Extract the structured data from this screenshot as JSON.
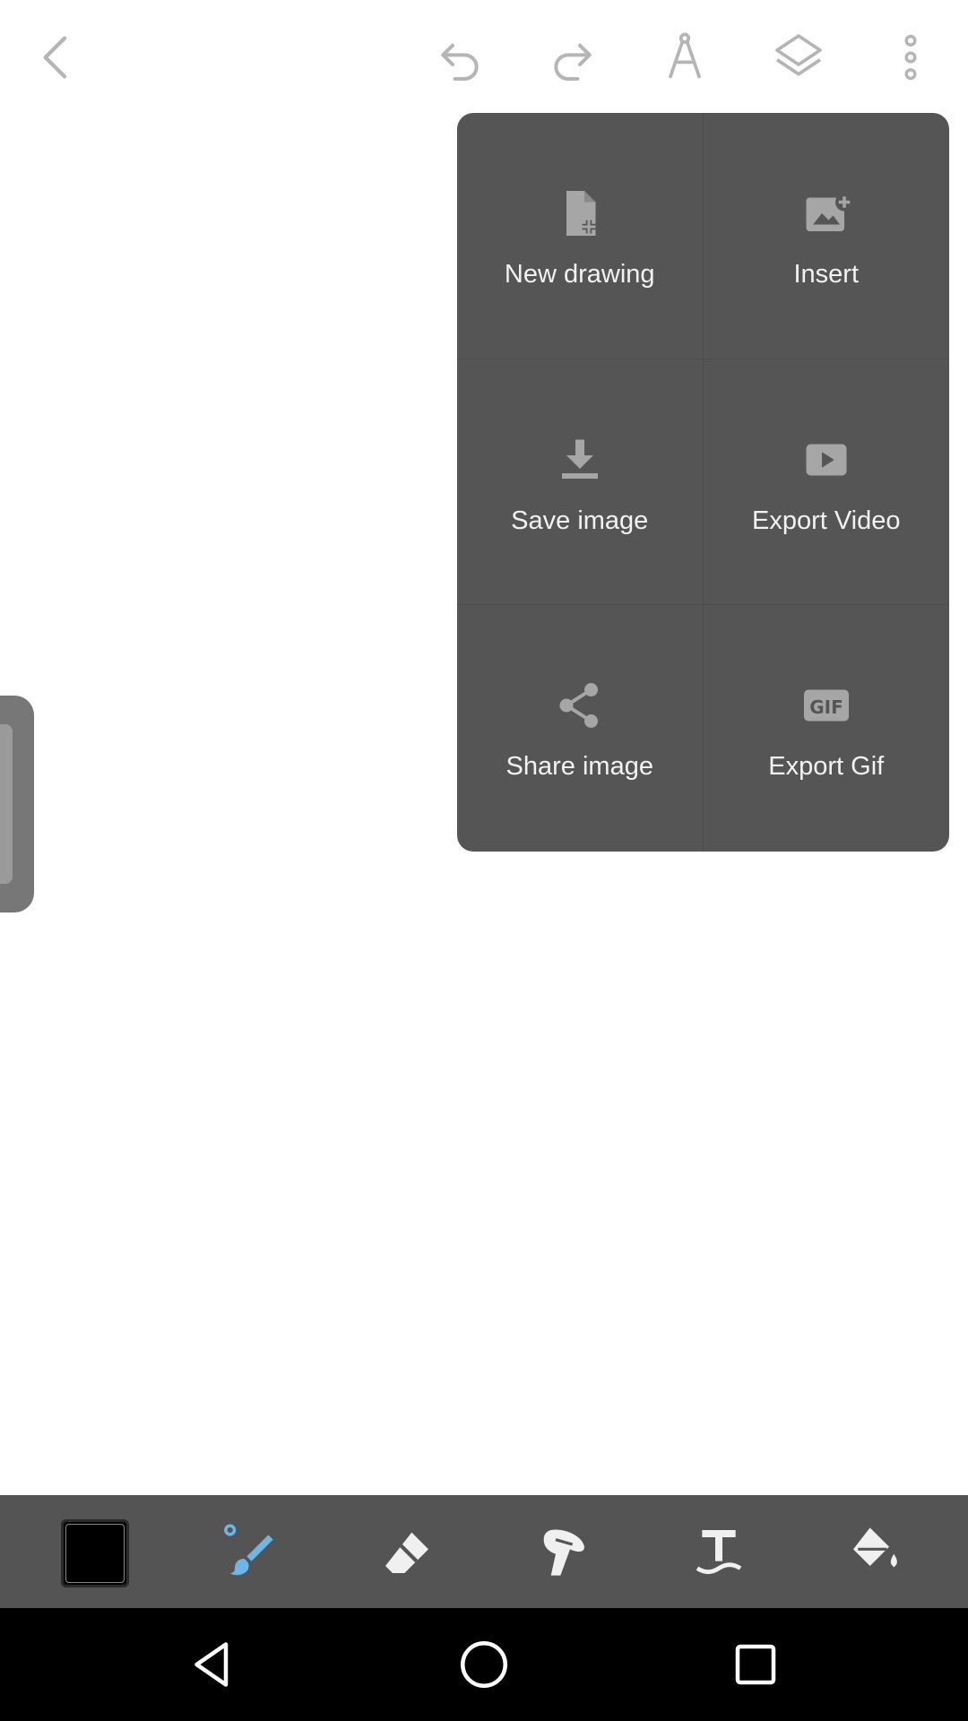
{
  "topbar": {
    "icons": [
      "back-chevron-icon",
      "undo-icon",
      "redo-icon",
      "compass-icon",
      "layers-icon",
      "more-vert-icon"
    ]
  },
  "menu": {
    "items": [
      {
        "label": "New drawing",
        "icon": "file-plus-icon"
      },
      {
        "label": "Insert",
        "icon": "image-plus-icon"
      },
      {
        "label": "Save image",
        "icon": "download-icon"
      },
      {
        "label": "Export Video",
        "icon": "video-play-icon"
      },
      {
        "label": "Share image",
        "icon": "share-icon"
      },
      {
        "label": "Export Gif",
        "icon": "gif-icon"
      }
    ],
    "gif_text": "GIF"
  },
  "toolbar": {
    "current_color": "#000000",
    "accent": "#6ab7e8",
    "tools": [
      "color-swatch",
      "brush-tool",
      "eraser-tool",
      "smudge-tool",
      "text-tool",
      "fill-tool"
    ]
  },
  "colors": {
    "menu_bg": "#555555",
    "toolbar_bg": "#545454",
    "icon_gray": "#9e9e9e"
  }
}
